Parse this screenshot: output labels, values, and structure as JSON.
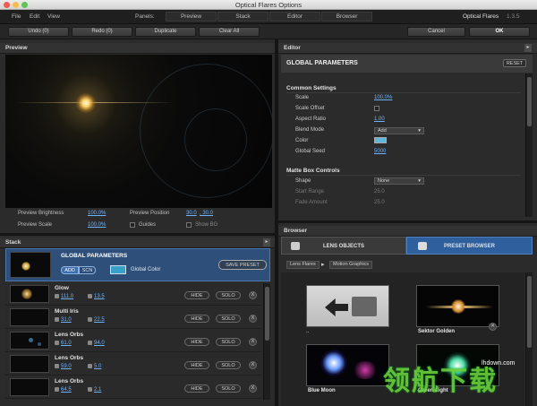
{
  "window": {
    "title": "Optical Flares Options"
  },
  "menu": {
    "file": "File",
    "edit": "Edit",
    "view": "View",
    "panels_label": "Panels:"
  },
  "panels": [
    "Preview",
    "Stack",
    "Editor",
    "Browser"
  ],
  "app": {
    "name": "Optical Flares",
    "version": "1.3.5"
  },
  "toolbar": {
    "undo": "Undo (0)",
    "redo": "Redo (0)",
    "duplicate": "Duplicate",
    "clear_all": "Clear All",
    "cancel": "Cancel",
    "ok": "OK"
  },
  "preview": {
    "header": "Preview",
    "brightness_label": "Preview Brightness",
    "brightness_value": "100.0%",
    "position_label": "Preview Position",
    "position_x": "30.0",
    "position_y": ", 30.0",
    "scale_label": "Preview Scale",
    "scale_value": "100.0%",
    "guides_label": "Guides",
    "show_bg_label": "Show BG"
  },
  "stack": {
    "header": "Stack",
    "global": {
      "title": "GLOBAL PARAMETERS",
      "add": "ADD",
      "scn": "SCN",
      "color_label": "Global Color",
      "save_preset": "SAVE PRESET",
      "color": "#3aa0c8"
    },
    "rows": [
      {
        "name": "Glow",
        "brightness": "111.0",
        "scale": "13.5"
      },
      {
        "name": "Multi Iris",
        "brightness": "31.0",
        "scale": "22.5"
      },
      {
        "name": "Lens Orbs",
        "brightness": "61.0",
        "scale": "94.0"
      },
      {
        "name": "Lens Orbs",
        "brightness": "59.0",
        "scale": "5.0"
      },
      {
        "name": "Lens Orbs",
        "brightness": "64.5",
        "scale": "2.1"
      }
    ],
    "hide": "HIDE",
    "solo": "SOLO",
    "x": "X"
  },
  "editor": {
    "header": "Editor",
    "title": "GLOBAL PARAMETERS",
    "reset": "RESET",
    "common_settings": "Common Settings",
    "scale_label": "Scale",
    "scale_value": "100.0%",
    "scale_offset_label": "Scale Offset",
    "aspect_label": "Aspect Ratio",
    "aspect_value": "1.00",
    "blend_label": "Blend Mode",
    "blend_value": "Add",
    "color_label": "Color",
    "color_value": "#5fb6d8",
    "seed_label": "Global Seed",
    "seed_value": "5000",
    "matte_box": "Matte Box Controls",
    "shape_label": "Shape",
    "shape_value": "None",
    "start_range_label": "Start Range",
    "start_range_value": "25.0",
    "fade_amount_label": "Fade Amount",
    "fade_amount_value": "25.0"
  },
  "browser": {
    "header": "Browser",
    "tab_lens": "LENS OBJECTS",
    "tab_preset": "PRESET BROWSER",
    "crumb1": "Lens Flares",
    "crumb2": "Motion Graphics",
    "presets": [
      "..",
      "Sektor Golden",
      "Blue Moon",
      "Green Light"
    ]
  },
  "watermark": {
    "big": "领航下载",
    "site": "lhdown.com"
  }
}
